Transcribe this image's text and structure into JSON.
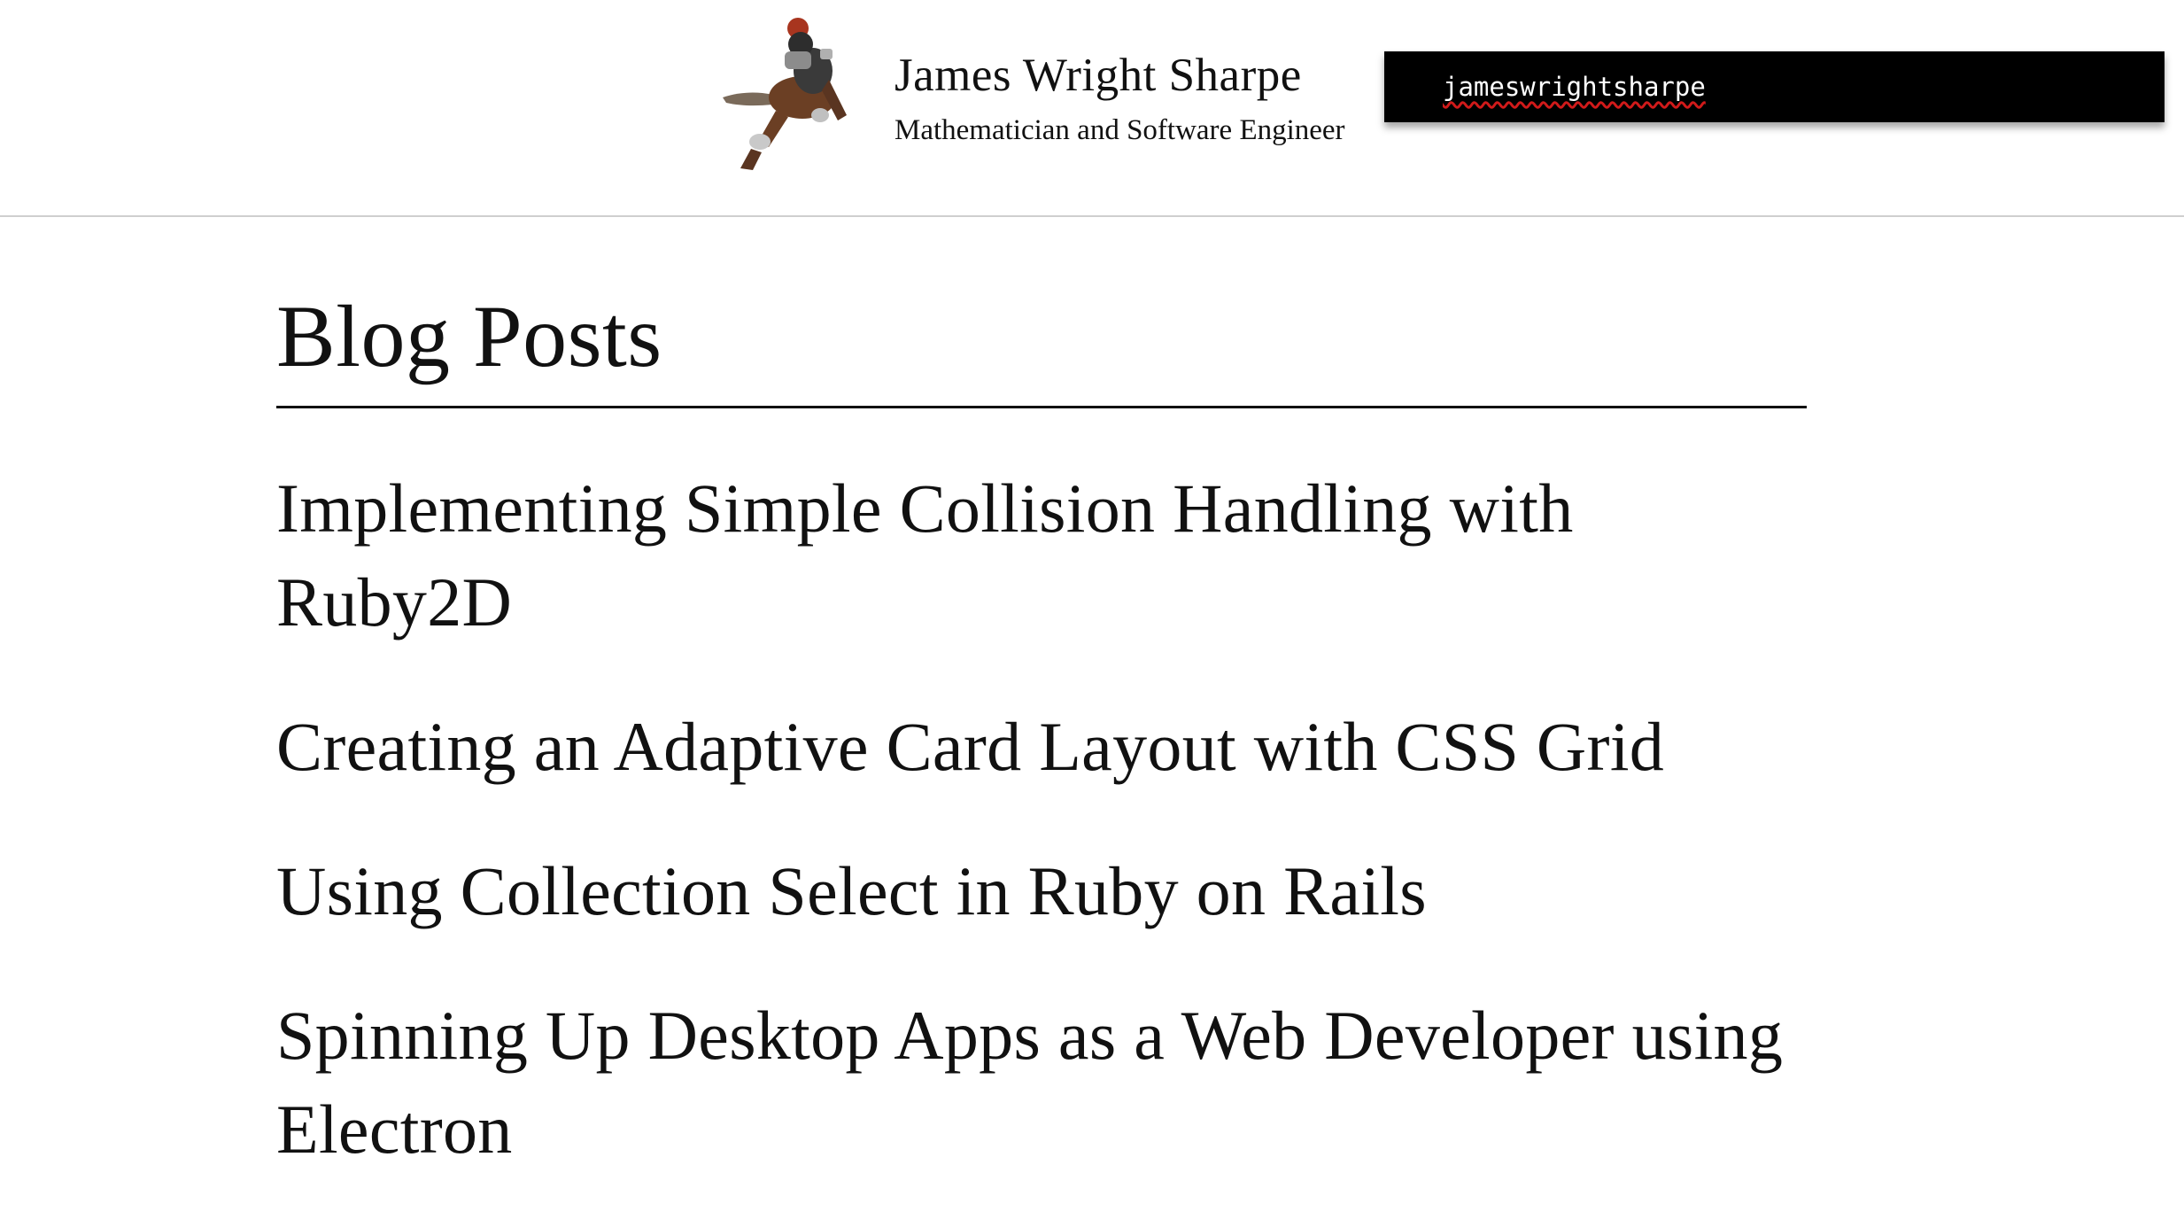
{
  "header": {
    "avatar_icon": "fantasy-warrior-avatar-icon",
    "site_title": "James Wright Sharpe",
    "site_subtitle": "Mathematician and Software Engineer",
    "handle": "jameswrightsharpe"
  },
  "main": {
    "page_title": "Blog Posts",
    "posts": [
      {
        "title": "Implementing Simple Collision Handling with Ruby2D"
      },
      {
        "title": "Creating an Adaptive Card Layout with CSS Grid"
      },
      {
        "title": "Using Collection Select in Ruby on Rails"
      },
      {
        "title": "Spinning Up Desktop Apps as a Web Developer using Electron"
      }
    ]
  },
  "colors": {
    "text": "#111111",
    "handle_box_bg": "#000000",
    "handle_text": "#ffffff",
    "spellcheck_underline": "#d11a1a",
    "header_border": "#cfcfcf"
  }
}
